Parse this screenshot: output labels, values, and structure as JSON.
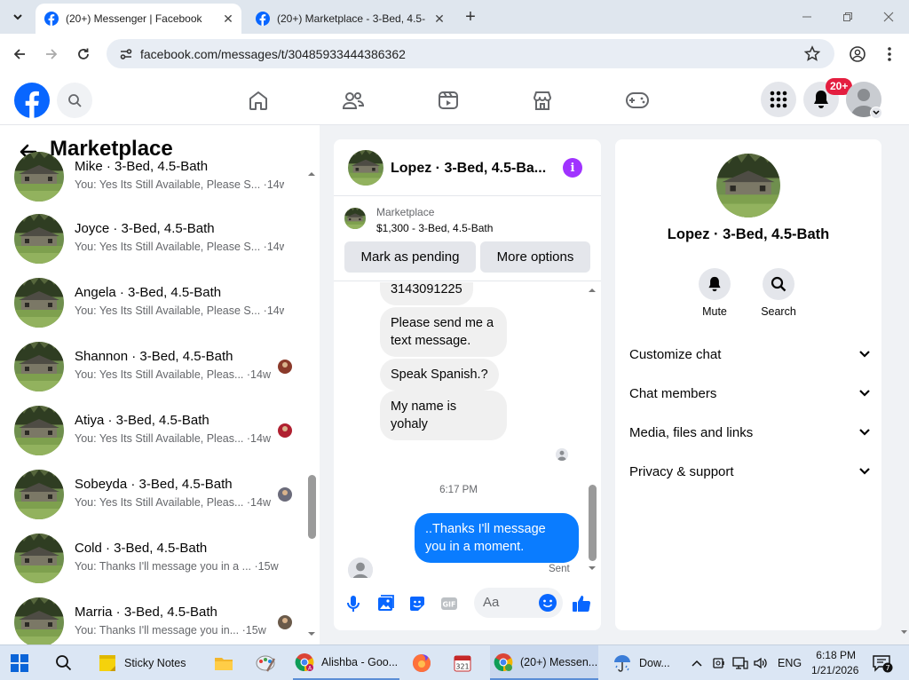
{
  "browser": {
    "tabs": [
      {
        "title": "(20+) Messenger | Facebook",
        "active": true
      },
      {
        "title": "(20+) Marketplace - 3-Bed, 4.5-",
        "active": false
      }
    ],
    "url": "facebook.com/messages/t/30485933444386362"
  },
  "fb": {
    "notification_badge": "20+",
    "brand_color": "#0866ff"
  },
  "left": {
    "title": "Marketplace",
    "conversations": [
      {
        "name": "Mike · 3-Bed, 4.5-Bath",
        "preview": "You: Yes Its Still Available, Please S...",
        "time": "·14w"
      },
      {
        "name": "Joyce · 3-Bed, 4.5-Bath",
        "preview": "You: Yes Its Still Available, Please S...",
        "time": "·14w"
      },
      {
        "name": "Angela · 3-Bed, 4.5-Bath",
        "preview": "You: Yes Its Still Available, Please S...",
        "time": "·14w"
      },
      {
        "name": "Shannon · 3-Bed, 4.5-Bath",
        "preview": "You: Yes Its Still Available, Pleas...",
        "time": "·14w"
      },
      {
        "name": "Atiya · 3-Bed, 4.5-Bath",
        "preview": "You: Yes Its Still Available, Pleas...",
        "time": "·14w"
      },
      {
        "name": "Sobeyda · 3-Bed, 4.5-Bath",
        "preview": "You: Yes Its Still Available, Pleas...",
        "time": "·14w"
      },
      {
        "name": "Cold · 3-Bed, 4.5-Bath",
        "preview": "You: Thanks I'll message you in a ...",
        "time": "·15w"
      },
      {
        "name": "Marria · 3-Bed, 4.5-Bath",
        "preview": "You: Thanks I'll message you in...",
        "time": "·15w"
      }
    ]
  },
  "chat": {
    "title": "Lopez · 3-Bed, 4.5-Ba...",
    "listing_source": "Marketplace",
    "listing_price": "$1,300 - 3-Bed, 4.5-Bath",
    "mark_pending": "Mark as pending",
    "more_options": "More options",
    "messages": [
      {
        "text": "3143091225",
        "from": "them"
      },
      {
        "text": "Please send me a text message.",
        "from": "them"
      },
      {
        "text": "Speak Spanish.?",
        "from": "them"
      },
      {
        "text": "My name is yohaly",
        "from": "them"
      },
      {
        "text": "..Thanks I'll message you in a moment.",
        "from": "me"
      }
    ],
    "time": "6:17 PM",
    "sent": "Sent",
    "input_placeholder": "Aa"
  },
  "right": {
    "title": "Lopez · 3-Bed, 4.5-Bath",
    "mute": "Mute",
    "search": "Search",
    "sections": [
      "Customize chat",
      "Chat members",
      "Media, files and links",
      "Privacy & support"
    ]
  },
  "taskbar": {
    "sticky": "Sticky Notes",
    "chrome1": "Alishba - Goo...",
    "chrome2": "(20+) Messen...",
    "weather": "Dow...",
    "lang": "ENG",
    "time": "6:18 PM",
    "date": "1/21/2026",
    "notif_count": "7"
  }
}
